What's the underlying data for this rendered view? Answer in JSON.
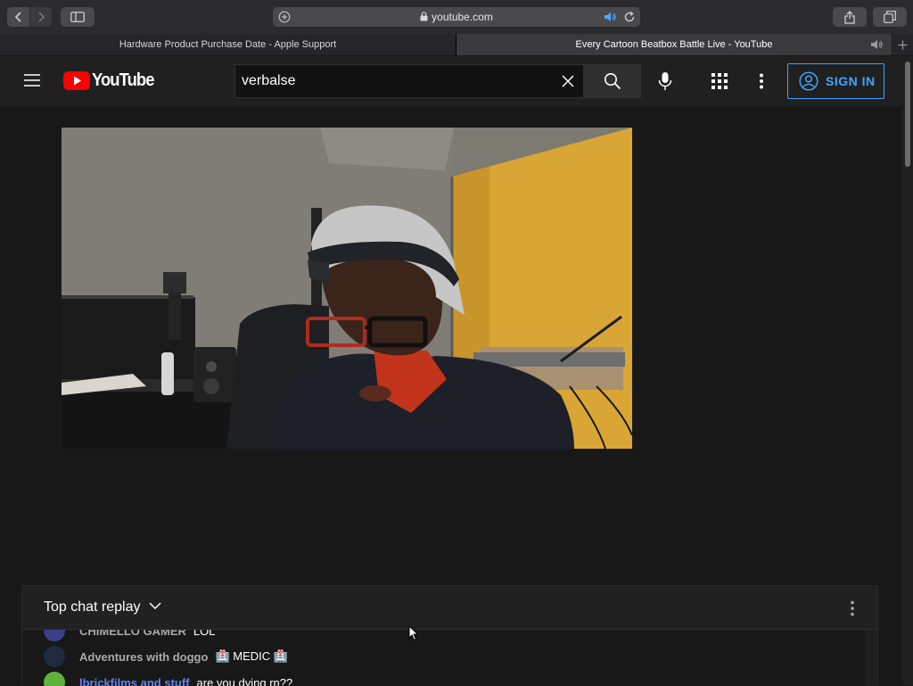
{
  "browser": {
    "url": "youtube.com",
    "tabs": [
      {
        "label": "Hardware Product Purchase Date - Apple Support"
      },
      {
        "label": "Every Cartoon Beatbox Battle Live - YouTube"
      }
    ]
  },
  "youtube": {
    "logo_text": "YouTube",
    "search": {
      "value": "verbalse"
    },
    "sign_in_label": "SIGN IN"
  },
  "chat": {
    "title": "Top chat replay",
    "messages": [
      {
        "author": "CHIMELLO GAMER",
        "text": "LOL"
      },
      {
        "author": "Adventures with doggo",
        "text": "🏥 MEDIC 🏥"
      },
      {
        "author": "lbrickfilms and stuff",
        "text": "are you dying rn??"
      }
    ]
  },
  "colors": {
    "accent": "#3ea6ff",
    "brand_red": "#ff0000",
    "background": "#181818",
    "header": "#202020"
  }
}
